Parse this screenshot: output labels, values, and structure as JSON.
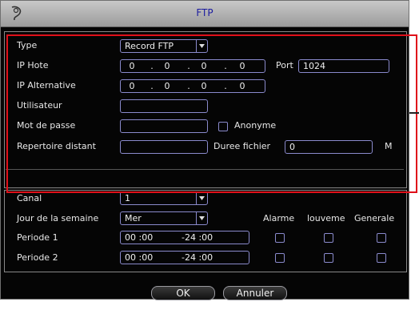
{
  "window": {
    "title": "FTP"
  },
  "ftp": {
    "type_label": "Type",
    "type_value": "Record FTP",
    "ip_host_label": "IP Hote",
    "ip_host": [
      "0",
      "0",
      "0",
      "0"
    ],
    "port_label": "Port",
    "port_value": "1024",
    "ip_alt_label": "IP Alternative",
    "ip_alt": [
      "0",
      "0",
      "0",
      "0"
    ],
    "user_label": "Utilisateur",
    "user_value": "",
    "password_label": "Mot de passe",
    "password_value": "",
    "anonymous_label": "Anonyme",
    "remote_dir_label": "Repertoire distant",
    "remote_dir_value": "",
    "file_duration_label": "Duree fichier",
    "file_duration_value": "0",
    "file_duration_unit": "M"
  },
  "schedule": {
    "channel_label": "Canal",
    "channel_value": "1",
    "weekday_label": "Jour de la semaine",
    "weekday_value": "Mer",
    "col_alarm": "Alarme",
    "col_motion": "louveme",
    "col_general": "Generale",
    "periods": [
      {
        "label": "Periode 1",
        "start": "00 :00",
        "end": "-24 :00"
      },
      {
        "label": "Periode 2",
        "start": "00 :00",
        "end": "-24 :00"
      }
    ]
  },
  "buttons": {
    "ok": "OK",
    "cancel": "Annuler"
  },
  "colors": {
    "highlight": "#e0101a",
    "title_text": "#1a1aa0",
    "field_border": "#8a8acc"
  }
}
